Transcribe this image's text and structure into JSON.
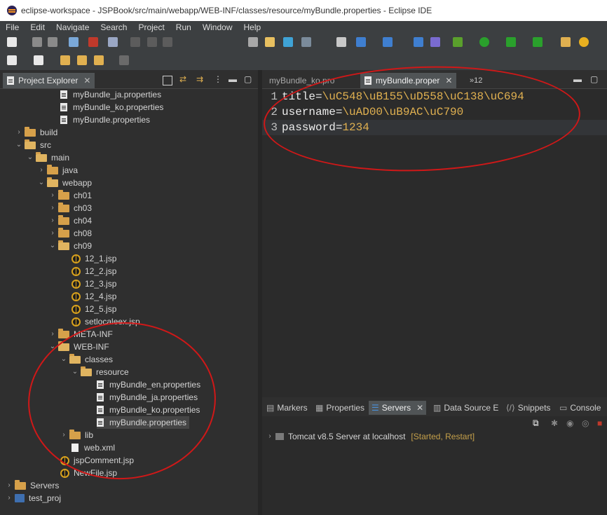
{
  "window": {
    "title": "eclipse-workspace - JSPBook/src/main/webapp/WEB-INF/classes/resource/myBundle.properties - Eclipse IDE"
  },
  "menu": [
    "File",
    "Edit",
    "Navigate",
    "Search",
    "Project",
    "Run",
    "Window",
    "Help"
  ],
  "explorer": {
    "tab_label": "Project Explorer",
    "tree": [
      {
        "label": "myBundle_ja.properties",
        "type": "file"
      },
      {
        "label": "myBundle_ko.properties",
        "type": "file"
      },
      {
        "label": "myBundle.properties",
        "type": "file"
      },
      {
        "label": "build",
        "type": "folder"
      },
      {
        "label": "src",
        "type": "folder"
      },
      {
        "label": "main",
        "type": "folder"
      },
      {
        "label": "java",
        "type": "folder"
      },
      {
        "label": "webapp",
        "type": "folder"
      },
      {
        "label": "ch01",
        "type": "folder"
      },
      {
        "label": "ch03",
        "type": "folder"
      },
      {
        "label": "ch04",
        "type": "folder"
      },
      {
        "label": "ch08",
        "type": "folder"
      },
      {
        "label": "ch09",
        "type": "folder"
      },
      {
        "label": "12_1.jsp",
        "type": "jsp"
      },
      {
        "label": "12_2.jsp",
        "type": "jsp"
      },
      {
        "label": "12_3.jsp",
        "type": "jsp"
      },
      {
        "label": "12_4.jsp",
        "type": "jsp"
      },
      {
        "label": "12_5.jsp",
        "type": "jsp"
      },
      {
        "label": "setlocaleex.jsp",
        "type": "jsp"
      },
      {
        "label": "META-INF",
        "type": "folder"
      },
      {
        "label": "WEB-INF",
        "type": "folder"
      },
      {
        "label": "classes",
        "type": "folder"
      },
      {
        "label": "resource",
        "type": "folder"
      },
      {
        "label": "myBundle_en.properties",
        "type": "file"
      },
      {
        "label": "myBundle_ja.properties",
        "type": "file"
      },
      {
        "label": "myBundle_ko.properties",
        "type": "file"
      },
      {
        "label": "myBundle.properties",
        "type": "file"
      },
      {
        "label": "lib",
        "type": "folder"
      },
      {
        "label": "web.xml",
        "type": "xml"
      },
      {
        "label": "jspComment.jsp",
        "type": "jsp"
      },
      {
        "label": "NewFile.jsp",
        "type": "jsp"
      },
      {
        "label": "Servers",
        "type": "project"
      },
      {
        "label": "test_proj",
        "type": "project"
      }
    ]
  },
  "editor": {
    "tabs": [
      {
        "label": "myBundle_ko.pro"
      },
      {
        "label": "myBundle.proper"
      },
      {
        "label": "»12"
      }
    ],
    "lines": [
      {
        "num": "1",
        "key": "title",
        "eq": "=",
        "value": "\\uC548\\uB155\\uD558\\uC138\\uC694"
      },
      {
        "num": "2",
        "key": "username",
        "eq": "=",
        "value": "\\uAD00\\uB9AC\\uC790"
      },
      {
        "num": "3",
        "key": "password",
        "eq": "=",
        "value": "1234"
      }
    ]
  },
  "bottom": {
    "tabs": [
      {
        "label": "Markers"
      },
      {
        "label": "Properties"
      },
      {
        "label": "Servers"
      },
      {
        "label": "Data Source E"
      },
      {
        "label": "Snippets"
      },
      {
        "label": "Console"
      }
    ],
    "server": {
      "name": "Tomcat v8.5 Server at localhost",
      "status": "[Started, Restart]"
    }
  },
  "colors": {
    "annotation": "#d01818",
    "property_value": "#e0b050",
    "folder": "#d6a04a"
  }
}
